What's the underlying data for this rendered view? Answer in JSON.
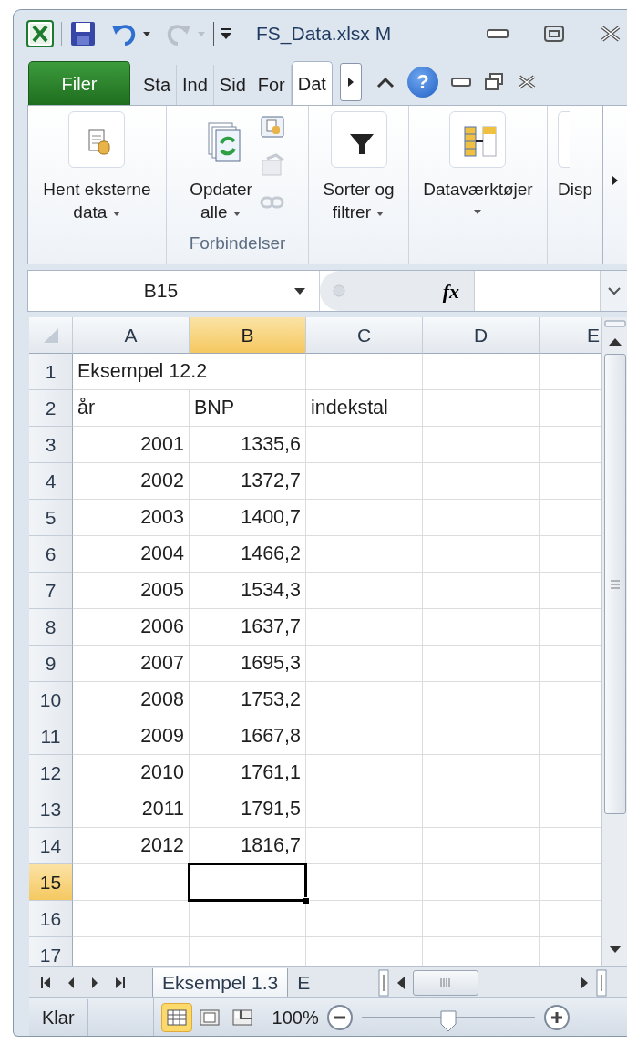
{
  "window": {
    "title": "FS_Data.xlsx M"
  },
  "ribbon_tabs": [
    {
      "label": "Filer",
      "kind": "file",
      "selected": false
    },
    {
      "label": "Sta",
      "kind": "tab",
      "selected": false
    },
    {
      "label": "Ind",
      "kind": "tab",
      "selected": false
    },
    {
      "label": "Sid",
      "kind": "tab",
      "selected": false
    },
    {
      "label": "For",
      "kind": "tab",
      "selected": false
    },
    {
      "label": "Dat",
      "kind": "tab",
      "selected": true
    }
  ],
  "help_label": "?",
  "ribbon": {
    "groups": [
      {
        "commands": [
          {
            "kind": "import",
            "label_lines": [
              "Hent eksterne",
              "data"
            ],
            "dropdown": true
          }
        ]
      },
      {
        "label": "Forbindelser",
        "commands": [
          {
            "kind": "refresh",
            "label_lines": [
              "Opdater",
              "alle"
            ],
            "dropdown": true
          },
          {
            "kind": "connections",
            "disabled": false
          },
          {
            "kind": "properties",
            "disabled": true
          },
          {
            "kind": "links",
            "disabled": true
          }
        ]
      },
      {
        "commands": [
          {
            "kind": "filter",
            "label_lines": [
              "Sorter og",
              "filtrer"
            ],
            "dropdown": true
          }
        ]
      },
      {
        "commands": [
          {
            "kind": "tools",
            "label_lines": [
              "Dataværktøjer"
            ],
            "dropdown": true
          }
        ]
      },
      {
        "commands": [
          {
            "kind": "partial",
            "label_lines": [
              "Disp"
            ],
            "dropdown": false
          }
        ]
      }
    ]
  },
  "formula_bar": {
    "name_box": "B15",
    "function_label": "fx"
  },
  "grid": {
    "columns": [
      {
        "label": "A",
        "selected": false
      },
      {
        "label": "B",
        "selected": true
      },
      {
        "label": "C",
        "selected": false
      },
      {
        "label": "D",
        "selected": false
      },
      {
        "label": "E",
        "selected": false
      }
    ],
    "rows": [
      {
        "header": "1",
        "selected": false,
        "cells": [
          {
            "text": "Eksempel 12.2",
            "kind": "text"
          }
        ]
      },
      {
        "header": "2",
        "selected": false,
        "cells": [
          {
            "text": "år",
            "kind": "text"
          },
          {
            "text": "BNP",
            "kind": "text"
          },
          {
            "text": "indekstal",
            "kind": "text"
          }
        ]
      },
      {
        "header": "3",
        "selected": false,
        "cells": [
          {
            "text": "2001",
            "kind": "number"
          },
          {
            "text": "1335,6",
            "kind": "number"
          }
        ]
      },
      {
        "header": "4",
        "selected": false,
        "cells": [
          {
            "text": "2002",
            "kind": "number"
          },
          {
            "text": "1372,7",
            "kind": "number"
          }
        ]
      },
      {
        "header": "5",
        "selected": false,
        "cells": [
          {
            "text": "2003",
            "kind": "number"
          },
          {
            "text": "1400,7",
            "kind": "number"
          }
        ]
      },
      {
        "header": "6",
        "selected": false,
        "cells": [
          {
            "text": "2004",
            "kind": "number"
          },
          {
            "text": "1466,2",
            "kind": "number"
          }
        ]
      },
      {
        "header": "7",
        "selected": false,
        "cells": [
          {
            "text": "2005",
            "kind": "number"
          },
          {
            "text": "1534,3",
            "kind": "number"
          }
        ]
      },
      {
        "header": "8",
        "selected": false,
        "cells": [
          {
            "text": "2006",
            "kind": "number"
          },
          {
            "text": "1637,7",
            "kind": "number"
          }
        ]
      },
      {
        "header": "9",
        "selected": false,
        "cells": [
          {
            "text": "2007",
            "kind": "number"
          },
          {
            "text": "1695,3",
            "kind": "number"
          }
        ]
      },
      {
        "header": "10",
        "selected": false,
        "cells": [
          {
            "text": "2008",
            "kind": "number"
          },
          {
            "text": "1753,2",
            "kind": "number"
          }
        ]
      },
      {
        "header": "11",
        "selected": false,
        "cells": [
          {
            "text": "2009",
            "kind": "number"
          },
          {
            "text": "1667,8",
            "kind": "number"
          }
        ]
      },
      {
        "header": "12",
        "selected": false,
        "cells": [
          {
            "text": "2010",
            "kind": "number"
          },
          {
            "text": "1761,1",
            "kind": "number"
          }
        ]
      },
      {
        "header": "13",
        "selected": false,
        "cells": [
          {
            "text": "2011",
            "kind": "number"
          },
          {
            "text": "1791,5",
            "kind": "number"
          }
        ]
      },
      {
        "header": "14",
        "selected": false,
        "cells": [
          {
            "text": "2012",
            "kind": "number"
          },
          {
            "text": "1816,7",
            "kind": "number"
          }
        ]
      },
      {
        "header": "15",
        "selected": true
      },
      {
        "header": "16",
        "selected": false
      },
      {
        "header": "17",
        "selected": false
      }
    ]
  },
  "sheet_tabs": [
    {
      "label": "Eksempel 1.3",
      "selected": true
    },
    {
      "label": "E",
      "selected": false
    }
  ],
  "status_bar": {
    "state": "Klar",
    "views": [
      {
        "kind": "normal",
        "selected": true
      },
      {
        "kind": "layout",
        "selected": false
      },
      {
        "kind": "pagebreak",
        "selected": false
      }
    ],
    "zoom": "100%",
    "zoom_slider": {
      "level": 0.5
    }
  }
}
